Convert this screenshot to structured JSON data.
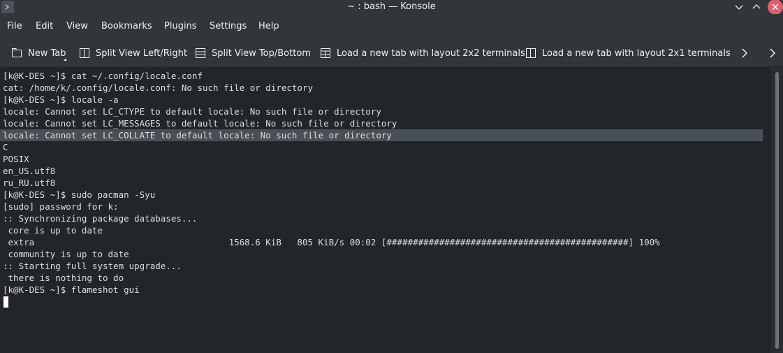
{
  "window": {
    "title": "~ : bash — Konsole"
  },
  "menu": {
    "items": [
      "File",
      "Edit",
      "View",
      "Bookmarks",
      "Plugins",
      "Settings",
      "Help"
    ]
  },
  "toolbar": {
    "new_tab": "New Tab",
    "split_lr": "Split View Left/Right",
    "split_tb": "Split View Top/Bottom",
    "layout_2x2": "Load a new tab with layout 2x2 terminals",
    "layout_2x1": "Load a new tab with layout 2x1 terminals"
  },
  "terminal": {
    "lines": [
      "[k@K-DES ~]$ cat ~/.config/locale.conf",
      "cat: /home/k/.config/locale.conf: No such file or directory",
      "[k@K-DES ~]$ locale -a",
      "locale: Cannot set LC_CTYPE to default locale: No such file or directory",
      "locale: Cannot set LC_MESSAGES to default locale: No such file or directory",
      "locale: Cannot set LC_COLLATE to default locale: No such file or directory",
      "C",
      "POSIX",
      "en_US.utf8",
      "ru_RU.utf8",
      "[k@K-DES ~]$ sudo pacman -Syu",
      "[sudo] password for k:",
      ":: Synchronizing package databases...",
      " core is up to date",
      " extra                                     1568.6 KiB   805 KiB/s 00:02 [##############################################] 100%",
      " community is up to date",
      ":: Starting full system upgrade...",
      " there is nothing to do",
      "[k@K-DES ~]$ flameshot gui"
    ],
    "highlighted_line": 5
  },
  "colors": {
    "chrome": "#31363b",
    "terminal_bg": "#232629",
    "highlight": "#475057",
    "close_button": "#e05f6f"
  }
}
